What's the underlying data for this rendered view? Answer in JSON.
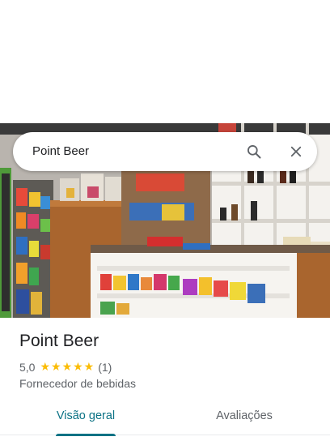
{
  "search": {
    "query": "Point Beer"
  },
  "place": {
    "name": "Point Beer",
    "rating": "5,0",
    "stars": "★★★★★",
    "review_count": "(1)",
    "category": "Fornecedor de bebidas"
  },
  "tabs": [
    {
      "label": "Visão geral",
      "active": true
    },
    {
      "label": "Avaliações",
      "active": false
    }
  ],
  "icons": {
    "search": "search-icon",
    "close": "close-icon"
  },
  "colors": {
    "accent": "#0b7285",
    "stars": "#fbbc04"
  }
}
